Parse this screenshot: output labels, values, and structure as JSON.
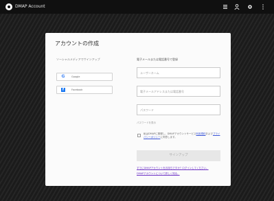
{
  "app": {
    "title": "DMAP Account"
  },
  "topbar_icons": [
    "menu-grid-icon",
    "user-icon",
    "settings-icon",
    "more-vert-icon"
  ],
  "card": {
    "title": "アカウントの作成",
    "social": {
      "title": "ソーシャルメディアでサインアップ",
      "google_label": "Google",
      "facebook_label": "Facebook"
    },
    "email": {
      "title": "電子メールまたは電話番号で登録",
      "username_placeholder": "ユーザーネーム",
      "email_placeholder": "電子メールアドレスまたは電話番号",
      "password_placeholder": "パスワード",
      "password_hint": "パスワードを表示"
    },
    "terms": {
      "prefix": "私はDMAPに登録し、DMAPアカウントサービス",
      "link1": "利用規約",
      "middle": "および",
      "link2": "プライバシーポリシー",
      "suffix": "に同意します。"
    },
    "signup_label": "サインアップ",
    "footer": {
      "link1": "すでにDMAPアカウントをお持ちですか？ログインしてください。",
      "link2": "DMAPアカウントについて詳しく知る。"
    }
  },
  "colors": {
    "background": "#1e1e1e",
    "topbar": "#101010",
    "card": "#fbfbfb",
    "link": "#3a55d6",
    "footer_link": "#6b2fc4",
    "google_blue": "#4285f4",
    "facebook_blue": "#1877f2"
  }
}
